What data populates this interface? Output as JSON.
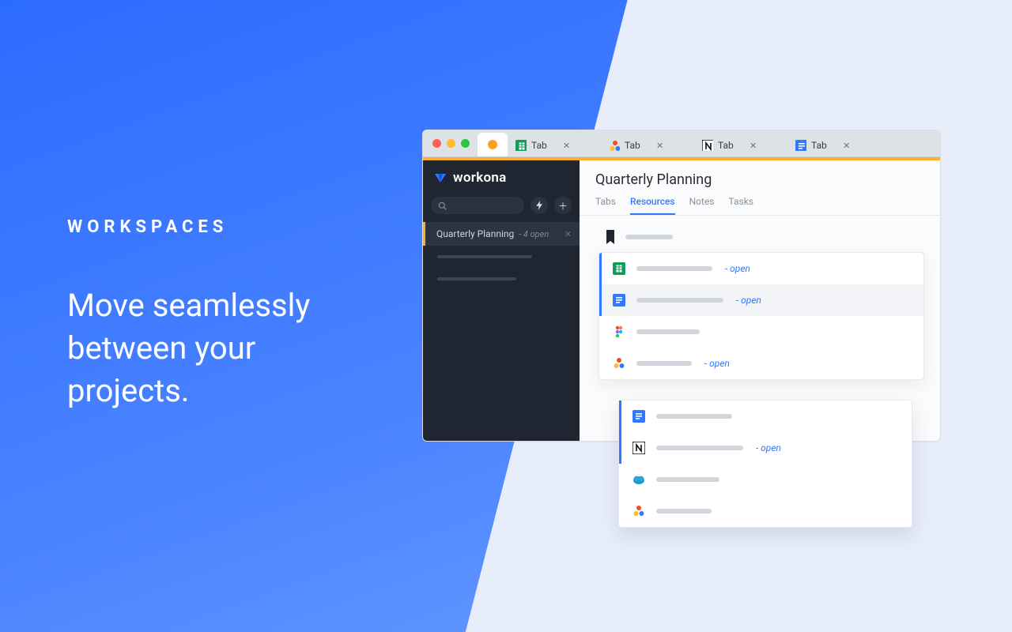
{
  "marketing": {
    "eyebrow": "WORKSPACES",
    "headline_l1": "Move seamlessly",
    "headline_l2": "between your",
    "headline_l3": "projects."
  },
  "browser": {
    "tabs": [
      {
        "label": "",
        "icon": "workona-dot"
      },
      {
        "label": "Tab",
        "icon": "sheets"
      },
      {
        "label": "Tab",
        "icon": "asana"
      },
      {
        "label": "Tab",
        "icon": "notion"
      },
      {
        "label": "Tab",
        "icon": "docs"
      }
    ]
  },
  "sidebar": {
    "brand": "workona",
    "workspace": {
      "name": "Quarterly Planning",
      "subtext": "- 4 open"
    }
  },
  "main": {
    "title": "Quarterly Planning",
    "tabs": [
      "Tabs",
      "Resources",
      "Notes",
      "Tasks"
    ],
    "active_tab": "Resources",
    "open_suffix": "- open",
    "resources_section1": [
      {
        "icon": "sheets",
        "open": true,
        "accent": true,
        "shade": false
      },
      {
        "icon": "docs",
        "open": true,
        "accent": true,
        "shade": true
      },
      {
        "icon": "figma",
        "open": false,
        "accent": false,
        "shade": false
      },
      {
        "icon": "asana",
        "open": true,
        "accent": false,
        "shade": false
      }
    ],
    "resources_section2": [
      {
        "icon": "docs",
        "open": false,
        "accent": true
      },
      {
        "icon": "notion",
        "open": true,
        "accent": true
      },
      {
        "icon": "salesforce",
        "open": false,
        "accent": false
      },
      {
        "icon": "asana",
        "open": false,
        "accent": false
      }
    ]
  }
}
